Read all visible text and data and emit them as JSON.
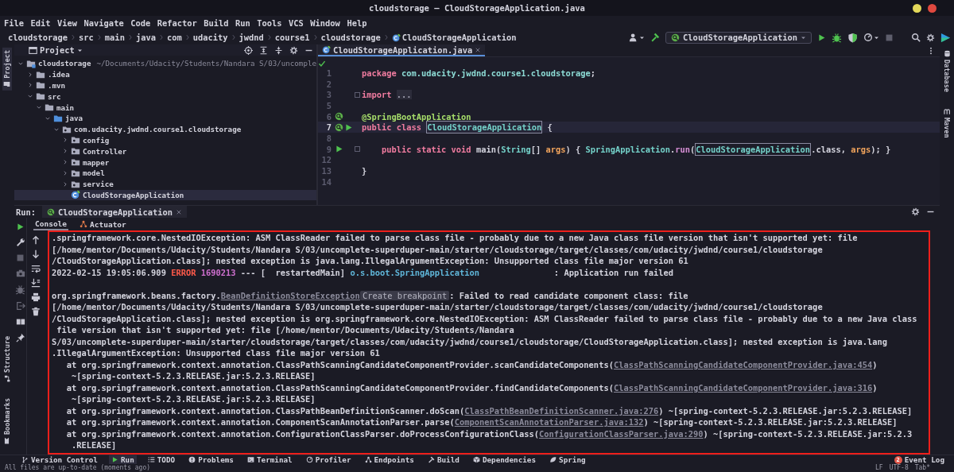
{
  "window": {
    "title": "cloudstorage – CloudStorageApplication.java"
  },
  "menu": [
    "File",
    "Edit",
    "View",
    "Navigate",
    "Code",
    "Refactor",
    "Build",
    "Run",
    "Tools",
    "VCS",
    "Window",
    "Help"
  ],
  "breadcrumb": [
    {
      "label": "cloudstorage",
      "kind": "folder"
    },
    {
      "label": "src",
      "kind": "folder"
    },
    {
      "label": "main",
      "kind": "folder"
    },
    {
      "label": "java",
      "kind": "folder"
    },
    {
      "label": "com",
      "kind": "folder"
    },
    {
      "label": "udacity",
      "kind": "folder"
    },
    {
      "label": "jwdnd",
      "kind": "folder"
    },
    {
      "label": "course1",
      "kind": "folder"
    },
    {
      "label": "cloudstorage",
      "kind": "folder"
    },
    {
      "label": "CloudStorageApplication",
      "kind": "class"
    }
  ],
  "toolbar": {
    "run_config": "CloudStorageApplication"
  },
  "stripes": {
    "left_top": [
      {
        "label": "Project",
        "kind": "project",
        "selected": true
      }
    ],
    "left_bottom": [
      {
        "label": "Structure",
        "kind": "structure",
        "selected": false
      },
      {
        "label": "Bookmarks",
        "kind": "bookmarks",
        "selected": false
      }
    ],
    "right": [
      {
        "label": "Database",
        "kind": "database",
        "selected": false
      },
      {
        "label": "Maven",
        "kind": "maven",
        "selected": false
      }
    ]
  },
  "project": {
    "title": "Project",
    "tree": [
      {
        "label": "cloudstorage",
        "path": "~/Documents/Udacity/Students/Nandara S/03/uncomple",
        "kind": "module",
        "expanded": true,
        "selected": false,
        "children": [
          {
            "label": ".idea",
            "kind": "folder",
            "expanded": false,
            "selected": false
          },
          {
            "label": ".mvn",
            "kind": "folder",
            "expanded": false,
            "selected": false
          },
          {
            "label": "src",
            "kind": "folder",
            "expanded": true,
            "selected": false,
            "children": [
              {
                "label": "main",
                "kind": "folder",
                "expanded": true,
                "selected": false,
                "children": [
                  {
                    "label": "java",
                    "kind": "source",
                    "expanded": true,
                    "selected": false,
                    "children": [
                      {
                        "label": "com.udacity.jwdnd.course1.cloudstorage",
                        "kind": "package",
                        "expanded": true,
                        "selected": false,
                        "children": [
                          {
                            "label": "config",
                            "kind": "package",
                            "expanded": false,
                            "selected": false
                          },
                          {
                            "label": "Controller",
                            "kind": "package",
                            "expanded": false,
                            "selected": false
                          },
                          {
                            "label": "mapper",
                            "kind": "package",
                            "expanded": false,
                            "selected": false
                          },
                          {
                            "label": "model",
                            "kind": "package",
                            "expanded": false,
                            "selected": false
                          },
                          {
                            "label": "service",
                            "kind": "package",
                            "expanded": false,
                            "selected": false
                          },
                          {
                            "label": "CloudStorageApplication",
                            "kind": "class",
                            "selected": true
                          }
                        ]
                      }
                    ]
                  }
                ]
              }
            ]
          }
        ]
      }
    ]
  },
  "editor": {
    "tab": "CloudStorageApplication.java",
    "lines": [
      {
        "number": "1",
        "fold": false,
        "current": false,
        "segments": [
          {
            "text": "package ",
            "kind": "keyword"
          },
          {
            "text": "com.udacity.jwdnd.course1.cloudstorage",
            "kind": "package"
          },
          {
            "text": ";",
            "kind": "plain"
          }
        ]
      },
      {
        "number": "2",
        "fold": false,
        "current": false
      },
      {
        "number": "3",
        "fold": true,
        "current": false,
        "segments": [
          {
            "text": "import ",
            "kind": "keyword"
          },
          {
            "text": "...",
            "kind": "folded"
          }
        ]
      },
      {
        "number": "5",
        "fold": false,
        "current": false
      },
      {
        "number": "6",
        "fold": false,
        "current": false,
        "gutter": [
          {
            "kind": "bean"
          }
        ],
        "segments": [
          {
            "text": "@SpringBootApplication",
            "kind": "annotation"
          }
        ]
      },
      {
        "number": "7",
        "fold": false,
        "current": true,
        "gutter": [
          {
            "kind": "bean"
          },
          {
            "kind": "run"
          }
        ],
        "segments": [
          {
            "text": "public class ",
            "kind": "keyword"
          },
          {
            "text": "CloudStorageApplication",
            "kind": "usage"
          },
          {
            "text": " {",
            "kind": "plain"
          }
        ]
      },
      {
        "number": "8",
        "fold": false,
        "current": false
      },
      {
        "number": "9",
        "fold": true,
        "current": false,
        "gutter": [
          {
            "kind": "run"
          }
        ],
        "segments": [
          {
            "text": "    public static void ",
            "kind": "keyword"
          },
          {
            "text": "main(",
            "kind": "plain"
          },
          {
            "text": "String",
            "kind": "type"
          },
          {
            "text": "[] ",
            "kind": "plain"
          },
          {
            "text": "args",
            "kind": "param"
          },
          {
            "text": ") { ",
            "kind": "plain"
          },
          {
            "text": "SpringApplication",
            "kind": "type"
          },
          {
            "text": ".",
            "kind": "plain"
          },
          {
            "text": "run",
            "kind": "method"
          },
          {
            "text": "(",
            "kind": "plain"
          },
          {
            "text": "CloudStorageApplication",
            "kind": "usage"
          },
          {
            "text": ".class, ",
            "kind": "plain"
          },
          {
            "text": "args",
            "kind": "param"
          },
          {
            "text": "); }",
            "kind": "plain"
          }
        ]
      },
      {
        "number": "12",
        "fold": false,
        "current": false
      },
      {
        "number": "13",
        "fold": false,
        "current": false,
        "segments": [
          {
            "text": "}",
            "kind": "plain"
          }
        ]
      },
      {
        "number": "14",
        "fold": false,
        "current": false
      }
    ]
  },
  "run": {
    "label": "Run:",
    "tab": "CloudStorageApplication",
    "tabs": [
      {
        "label": "Console",
        "kind": "console",
        "selected": true
      },
      {
        "label": "Actuator",
        "kind": "actuator",
        "selected": false
      }
    ],
    "console": [
      {
        "kind": "output",
        "segments": [
          {
            "text": ".springframework.core.NestedIOException: ASM ClassReader failed to parse class file - probably due to a new Java class file version that isn't supported yet: file",
            "kind": "text"
          }
        ]
      },
      {
        "kind": "output",
        "segments": [
          {
            "text": "[/home/mentor/Documents/Udacity/Students/Nandara S/03/uncomplete-superduper-main/starter/cloudstorage/target/classes/com/udacity/jwdnd/course1/cloudstorage",
            "kind": "text"
          }
        ]
      },
      {
        "kind": "output",
        "segments": [
          {
            "text": "/CloudStorageApplication.class]; nested exception is java.lang.IllegalArgumentException: Unsupported class file major version 61",
            "kind": "text"
          }
        ]
      },
      {
        "kind": "output",
        "segments": [
          {
            "text": "2022-02-15 19:05:06.909 ",
            "kind": "text"
          },
          {
            "text": "ERROR ",
            "kind": "error"
          },
          {
            "text": "1690213",
            "kind": "pid"
          },
          {
            "text": " --- [  restartedMain] ",
            "kind": "text"
          },
          {
            "text": "o.s.boot.SpringApplication",
            "kind": "logger"
          },
          {
            "text": "               : Application run failed",
            "kind": "text"
          }
        ]
      },
      {
        "kind": "blank"
      },
      {
        "kind": "output",
        "segments": [
          {
            "text": "org.springframework.beans.factory.",
            "kind": "text"
          },
          {
            "text": "BeanDefinitionStoreException",
            "kind": "link"
          },
          {
            "text": "Create breakpoint",
            "kind": "hint"
          },
          {
            "text": ": Failed to read candidate component class: file",
            "kind": "text"
          }
        ]
      },
      {
        "kind": "output",
        "segments": [
          {
            "text": "[/home/mentor/Documents/Udacity/Students/Nandara S/03/uncomplete-superduper-main/starter/cloudstorage/target/classes/com/udacity/jwdnd/course1/cloudstorage",
            "kind": "text"
          }
        ]
      },
      {
        "kind": "output",
        "segments": [
          {
            "text": "/CloudStorageApplication.class]; nested exception is org.springframework.core.NestedIOException: ASM ClassReader failed to parse class file - probably due to a new Java class",
            "kind": "text"
          }
        ]
      },
      {
        "kind": "output",
        "segments": [
          {
            "text": " file version that isn't supported yet: file [/home/mentor/Documents/Udacity/Students/Nandara",
            "kind": "text"
          }
        ]
      },
      {
        "kind": "output",
        "segments": [
          {
            "text": "S/03/uncomplete-superduper-main/starter/cloudstorage/target/classes/com/udacity/jwdnd/course1/cloudstorage/CloudStorageApplication.class]; nested exception is java.lang",
            "kind": "text"
          }
        ]
      },
      {
        "kind": "output",
        "segments": [
          {
            "text": ".IllegalArgumentException: Unsupported class file major version 61",
            "kind": "text"
          }
        ]
      },
      {
        "kind": "output",
        "segments": [
          {
            "text": "   at org.springframework.context.annotation.ClassPathScanningCandidateComponentProvider.scanCandidateComponents(",
            "kind": "text"
          },
          {
            "text": "ClassPathScanningCandidateComponentProvider.java:454",
            "kind": "link"
          },
          {
            "text": ")",
            "kind": "text"
          }
        ]
      },
      {
        "kind": "output",
        "segments": [
          {
            "text": "    ~[spring-context-5.2.3.RELEASE.jar:5.2.3.RELEASE]",
            "kind": "text"
          }
        ]
      },
      {
        "kind": "output",
        "segments": [
          {
            "text": "   at org.springframework.context.annotation.ClassPathScanningCandidateComponentProvider.findCandidateComponents(",
            "kind": "text"
          },
          {
            "text": "ClassPathScanningCandidateComponentProvider.java:316",
            "kind": "link"
          },
          {
            "text": ")",
            "kind": "text"
          }
        ]
      },
      {
        "kind": "output",
        "segments": [
          {
            "text": "    ~[spring-context-5.2.3.RELEASE.jar:5.2.3.RELEASE]",
            "kind": "text"
          }
        ]
      },
      {
        "kind": "output",
        "segments": [
          {
            "text": "   at org.springframework.context.annotation.ClassPathBeanDefinitionScanner.doScan(",
            "kind": "text"
          },
          {
            "text": "ClassPathBeanDefinitionScanner.java:276",
            "kind": "link"
          },
          {
            "text": ") ~[spring-context-5.2.3.RELEASE.jar:5.2.3.RELEASE]",
            "kind": "text"
          }
        ]
      },
      {
        "kind": "output",
        "segments": [
          {
            "text": "   at org.springframework.context.annotation.ComponentScanAnnotationParser.parse(",
            "kind": "text"
          },
          {
            "text": "ComponentScanAnnotationParser.java:132",
            "kind": "link"
          },
          {
            "text": ") ~[spring-context-5.2.3.RELEASE.jar:5.2.3.RELEASE]",
            "kind": "text"
          }
        ]
      },
      {
        "kind": "output",
        "segments": [
          {
            "text": "   at org.springframework.context.annotation.ConfigurationClassParser.doProcessConfigurationClass(",
            "kind": "text"
          },
          {
            "text": "ConfigurationClassParser.java:290",
            "kind": "link"
          },
          {
            "text": ") ~[spring-context-5.2.3.RELEASE.jar:5.2.3",
            "kind": "text"
          }
        ]
      },
      {
        "kind": "output",
        "segments": [
          {
            "text": "    .RELEASE]",
            "kind": "text"
          }
        ]
      }
    ]
  },
  "tool_windows": [
    {
      "label": "Version Control",
      "kind": "vcs",
      "selected": false
    },
    {
      "label": "Run",
      "kind": "run",
      "selected": true
    },
    {
      "label": "TODO",
      "kind": "todo",
      "selected": false
    },
    {
      "label": "Problems",
      "kind": "problems",
      "selected": false
    },
    {
      "label": "Terminal",
      "kind": "terminal",
      "selected": false
    },
    {
      "label": "Profiler",
      "kind": "profiler",
      "selected": false
    },
    {
      "label": "Endpoints",
      "kind": "endpoints",
      "selected": false
    },
    {
      "label": "Build",
      "kind": "build",
      "selected": false
    },
    {
      "label": "Dependencies",
      "kind": "dependencies",
      "selected": false
    },
    {
      "label": "Spring",
      "kind": "spring",
      "selected": false
    }
  ],
  "event_log": {
    "label": "Event Log",
    "badge": "2"
  },
  "status_bar": {
    "message": "All files are up-to-date (moments ago)",
    "items": [
      "LF",
      "UTF-8",
      "Tab*"
    ]
  }
}
